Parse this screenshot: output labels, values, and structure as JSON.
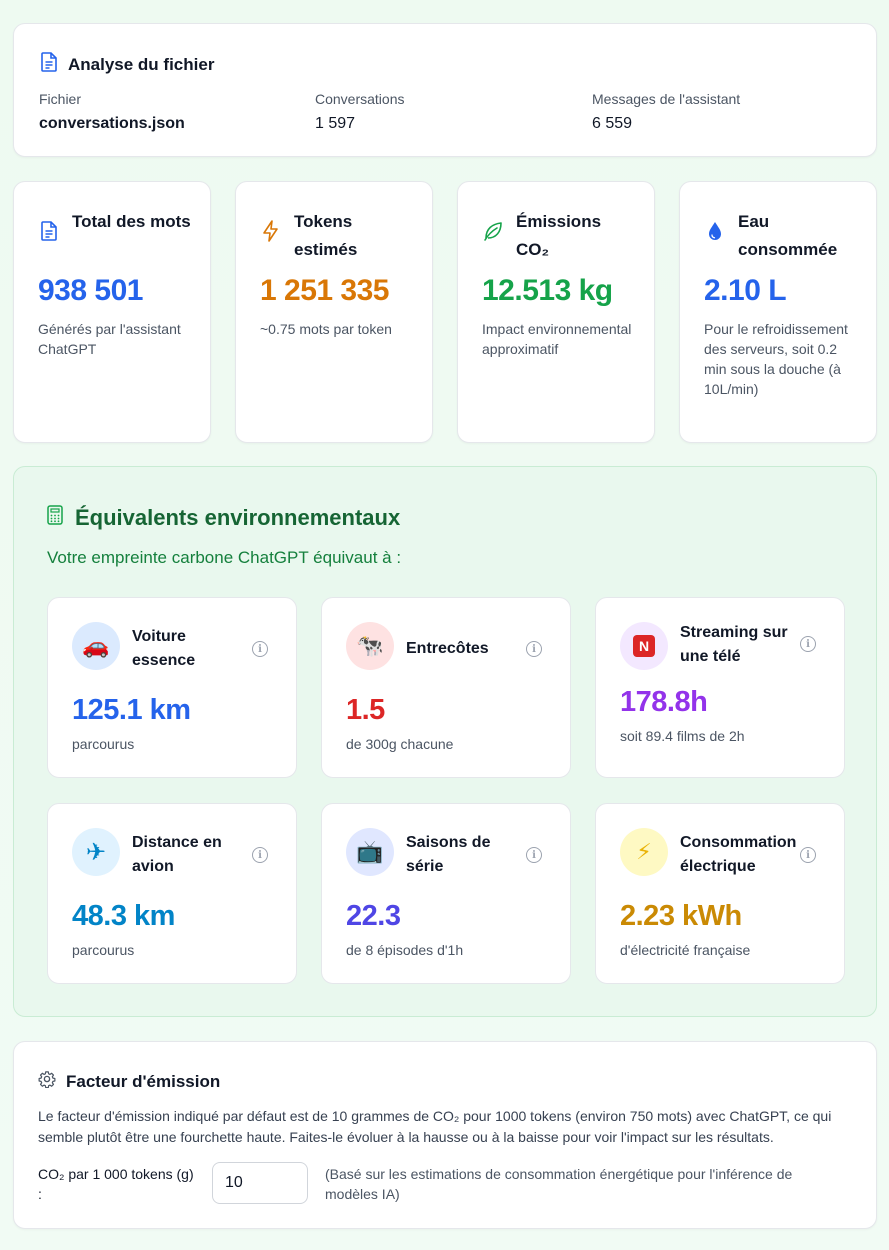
{
  "file_analysis": {
    "title": "Analyse du fichier",
    "file_label": "Fichier",
    "file_value": "conversations.json",
    "conversations_label": "Conversations",
    "conversations_value": "1 597",
    "messages_label": "Messages de l'assistant",
    "messages_value": "6 559"
  },
  "stats": [
    {
      "title": "Total des mots",
      "value": "938 501",
      "desc": "Générés par l'assistant ChatGPT",
      "color": "#2563eb",
      "icon": "document-icon"
    },
    {
      "title": "Tokens estimés",
      "value": "1 251 335",
      "desc": "~0.75 mots par token",
      "color": "#d97706",
      "icon": "lightning-icon"
    },
    {
      "title": "Émissions CO₂",
      "value": "12.513 kg",
      "desc": "Impact environnemental approximatif",
      "color": "#16a34a",
      "icon": "leaf-icon"
    },
    {
      "title": "Eau consommée",
      "value": "2.10 L",
      "desc": "Pour le refroidissement des serveurs, soit 0.2 min sous la douche (à 10L/min)",
      "color": "#2563eb",
      "icon": "water-drop-icon"
    }
  ],
  "equivalents": {
    "title": "Équivalents environnementaux",
    "subtitle": "Votre empreinte carbone ChatGPT équivaut à :",
    "items": [
      {
        "label": "Voiture essence",
        "value": "125.1 km",
        "desc": "parcourus",
        "color": "#2563eb",
        "badge_bg": "#dbeafe",
        "icon": "car-icon",
        "glyph": "🚗"
      },
      {
        "label": "Entrecôtes",
        "value": "1.5",
        "desc": "de 300g chacune",
        "color": "#dc2626",
        "badge_bg": "#fee2e2",
        "icon": "cow-icon",
        "glyph": "🐄"
      },
      {
        "label": "Streaming sur une télé",
        "value": "178.8h",
        "desc": "soit 89.4 films de 2h",
        "color": "#9333ea",
        "badge_bg": "#f3e8ff",
        "icon": "netflix-icon",
        "glyph": "N"
      },
      {
        "label": "Distance en avion",
        "value": "48.3 km",
        "desc": "parcourus",
        "color": "#0284c7",
        "badge_bg": "#e0f2fe",
        "icon": "airplane-icon",
        "glyph": "✈"
      },
      {
        "label": "Saisons de série",
        "value": "22.3",
        "desc": "de 8 épisodes d'1h",
        "color": "#4f46e5",
        "badge_bg": "#e0e7ff",
        "icon": "television-icon",
        "glyph": "📺"
      },
      {
        "label": "Consommation électrique",
        "value": "2.23 kWh",
        "desc": "d'électricité française",
        "color": "#ca8a04",
        "badge_bg": "#fef9c3",
        "icon": "lightning-icon",
        "glyph": "⚡"
      }
    ]
  },
  "emission_factor": {
    "title": "Facteur d'émission",
    "text": "Le facteur d'émission indiqué par défaut est de 10 grammes de CO₂ pour 1000 tokens (environ 750 mots) avec ChatGPT, ce qui semble plutôt être une fourchette haute. Faites-le évoluer à la hausse ou à la baisse pour voir l'impact sur les résultats.",
    "input_label": "CO₂ par 1 000 tokens (g) :",
    "input_value": "10",
    "note": "(Basé sur les estimations de consommation énergétique pour l'inférence de modèles IA)"
  }
}
